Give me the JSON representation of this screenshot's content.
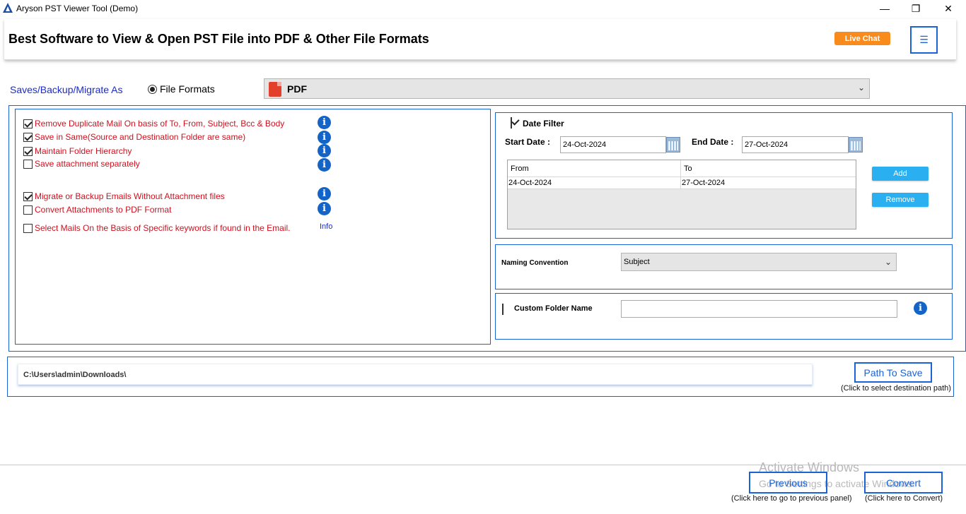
{
  "window": {
    "title": "Aryson PST Viewer Tool (Demo)",
    "minimize_glyph": "—",
    "restore_glyph": "❐",
    "close_glyph": "✕"
  },
  "header": {
    "title": "Best Software to View & Open PST File into PDF & Other File Formats",
    "live_chat_label": "Live Chat",
    "menu_glyph": "☰",
    "accent_color": "#f98b1c"
  },
  "save_as": {
    "label": "Saves/Backup/Migrate As",
    "radio_label": "File Formats",
    "selected_format": "PDF",
    "chevron_glyph": "⌄"
  },
  "options": {
    "items": [
      {
        "label": "Remove Duplicate Mail On basis of To, From, Subject, Bcc & Body",
        "checked": true,
        "info_icon": true
      },
      {
        "label": "Save in Same(Source and Destination Folder are same)",
        "checked": true,
        "info_icon": true
      },
      {
        "label": "Maintain Folder Hierarchy",
        "checked": true,
        "info_icon": true
      },
      {
        "label": "Save attachment separately",
        "checked": false,
        "info_icon": true
      },
      {
        "label": "Migrate or Backup Emails Without Attachment files",
        "checked": true,
        "info_icon": true
      },
      {
        "label": "Convert Attachments to PDF Format",
        "checked": false,
        "info_icon": true
      },
      {
        "label": "Select Mails On the Basis of Specific keywords if found in the Email.",
        "checked": false,
        "info_icon": false
      }
    ],
    "info_link": "Info",
    "info_glyph": "i"
  },
  "date_filter": {
    "label": "Date Filter",
    "checked": true,
    "start_label": "Start Date :",
    "start_value": "24-Oct-2024",
    "end_label": "End Date :",
    "end_value": "27-Oct-2024",
    "table": {
      "headers": [
        "From",
        "To"
      ],
      "rows": [
        [
          "24-Oct-2024",
          "27-Oct-2024"
        ]
      ]
    },
    "add_label": "Add",
    "remove_label": "Remove"
  },
  "naming": {
    "label": "Naming Convention",
    "value": "Subject",
    "chevron_glyph": "⌄"
  },
  "custom_folder": {
    "label": "Custom Folder Name",
    "checked": false,
    "value": "",
    "info_glyph": "i"
  },
  "path": {
    "value": "C:\\Users\\admin\\Downloads\\",
    "button_label": "Path To Save",
    "hint": "(Click to select destination path)"
  },
  "footer": {
    "previous_label": "Previous",
    "previous_hint": "(Click here to go to previous panel)",
    "convert_label": "Convert",
    "convert_hint": "(Click here to Convert)"
  },
  "watermark": {
    "title": "Activate Windows",
    "subtitle": "Go to Settings to activate Windows."
  }
}
